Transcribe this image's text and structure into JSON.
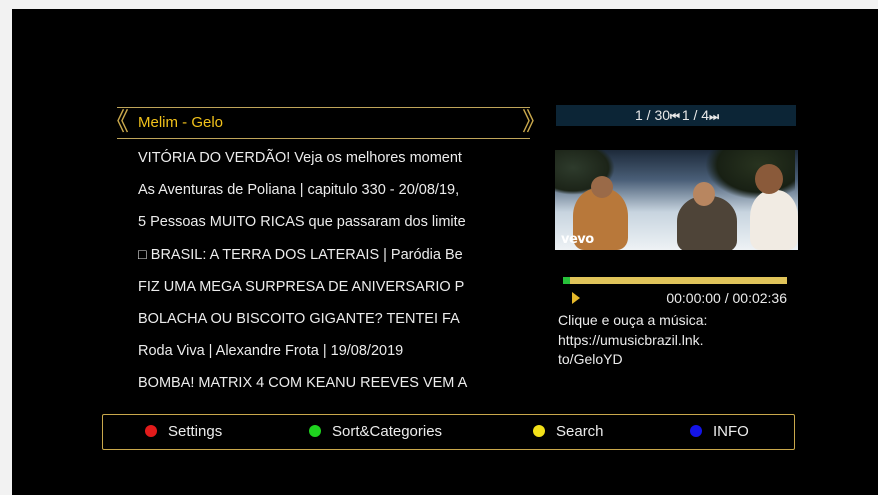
{
  "category": {
    "title": "Melim - Gelo",
    "prev_glyph": "《",
    "next_glyph": "》"
  },
  "videos": [
    "VITÓRIA DO VERDÃO! Veja os melhores moment",
    "As Aventuras de Poliana | capitulo 330 - 20/08/19,",
    "5 Pessoas MUITO RICAS que passaram dos limite",
    "□ BRASIL: A TERRA DOS LATERAIS | Paródia Be",
    "FIZ UMA MEGA SURPRESA DE ANIVERSARIO P",
    "BOLACHA OU BISCOITO GIGANTE? TENTEI FA",
    "Roda Viva | Alexandre Frota | 19/08/2019",
    "BOMBA! MATRIX 4 COM KEANU REEVES VEM A"
  ],
  "pager": {
    "list_page": "1 / 30",
    "prev_glyph": "⏮",
    "item_page": "1 / 4",
    "next_glyph": "⏭"
  },
  "preview": {
    "watermark": "vevo",
    "progress": 0.03,
    "time": "00:00:00 / 00:02:36",
    "description": "Clique e ouça a música:\nhttps://umusicbrazil.lnk.\nto/GeloYD"
  },
  "footer": {
    "buttons": [
      {
        "label": "Settings",
        "color": "#e21b1b",
        "icon": "red-key-icon"
      },
      {
        "label": "Sort&Categories",
        "color": "#1fd31f",
        "icon": "green-key-icon"
      },
      {
        "label": "Search",
        "color": "#f2e019",
        "icon": "yellow-key-icon"
      },
      {
        "label": "INFO",
        "color": "#1414e8",
        "icon": "blue-key-icon"
      }
    ]
  },
  "colors": {
    "accent_gold": "#c9a84c",
    "title_yellow": "#f2c21b",
    "pager_bg": "#0c2536"
  }
}
